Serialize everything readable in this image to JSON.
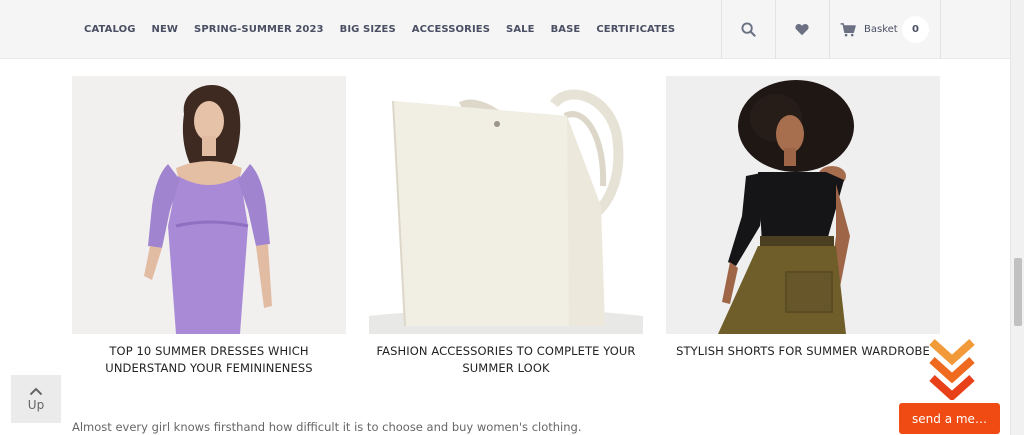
{
  "nav": {
    "items": [
      "CATALOG",
      "NEW",
      "SPRING-SUMMER 2023",
      "BIG SIZES",
      "ACCESSORIES",
      "SALE",
      "BASE",
      "CERTIFICATES"
    ]
  },
  "header": {
    "basket_label": "Basket",
    "basket_count": "0"
  },
  "cards": [
    {
      "title": "TOP 10 SUMMER DRESSES WHICH UNDERSTAND YOUR FEMININENESS",
      "image": "woman in lavender dress"
    },
    {
      "title": "FASHION ACCESSORIES TO COMPLETE YOUR SUMMER LOOK",
      "image": "cream leather tote bag"
    },
    {
      "title": "STYLISH SHORTS FOR SUMMER WARDROBE",
      "image": "woman in black top and olive shorts"
    }
  ],
  "intro_text": "Almost every girl knows firsthand how difficult it is to choose and buy women's clothing.",
  "up_button": {
    "label": "Up"
  },
  "send_button": {
    "label": "send a me…"
  },
  "colors": {
    "accent": "#ef4b12",
    "nav_text": "#4a4f63",
    "header_bg": "#f5f5f5"
  },
  "icons": [
    "search-icon",
    "heart-icon",
    "cart-icon",
    "chevron-up-icon",
    "triple-chevron-down-icon"
  ]
}
